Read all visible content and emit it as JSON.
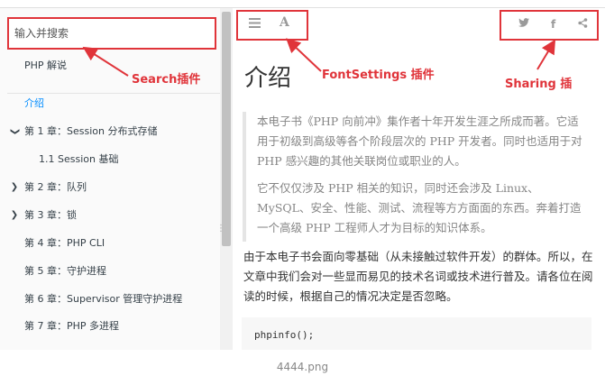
{
  "search": {
    "placeholder": "输入并搜索"
  },
  "sidebar": {
    "items": [
      {
        "label": "PHP 解说",
        "chevron": ""
      },
      {
        "label": "介绍",
        "chevron": ""
      },
      {
        "label": "第 1 章：Session 分布式存储",
        "chevron": "❯"
      },
      {
        "label": "1.1 Session 基础",
        "chevron": ""
      },
      {
        "label": "第 2 章：队列",
        "chevron": "❯"
      },
      {
        "label": "第 3 章：锁",
        "chevron": "❯"
      },
      {
        "label": "第 4 章：PHP CLI",
        "chevron": ""
      },
      {
        "label": "第 5 章：守护进程",
        "chevron": ""
      },
      {
        "label": "第 6 章：Supervisor 管理守护进程",
        "chevron": ""
      },
      {
        "label": "第 7 章：PHP 多进程",
        "chevron": ""
      }
    ],
    "active_index": 1,
    "expanded_index": 2
  },
  "toolbar": {
    "menu_icon": "hamburger-menu-icon",
    "font_icon": "font-settings-icon",
    "font_glyph": "A",
    "share_icons": [
      "twitter-icon",
      "facebook-icon",
      "share-icon"
    ],
    "twitter_glyph": "🐦",
    "facebook_glyph": "f",
    "share_glyph": "⋖"
  },
  "annotations": {
    "search": "Search插件",
    "font": "FontSettings 插件",
    "sharing": "Sharing 插",
    "color": "#e0343a"
  },
  "content": {
    "title": "介绍",
    "quote_p1": "本电子书《PHP 向前冲》集作者十年开发生涯之所成而著。它适用于初级到高级等各个阶段层次的 PHP 开发者。同时也适用于对 PHP 感兴趣的其他关联岗位或职业的人。",
    "quote_p2": "它不仅仅涉及 PHP 相关的知识，同时还会涉及 Linux、MySQL、安全、性能、测试、流程等方方面面的东西。奔着打造一个高级 PHP 工程师人才为目标的知识体系。",
    "body": "由于本电子书会面向零基础（从未接触过软件开发）的群体。所以，在文章中我们会对一些显而易见的技术名词或技术进行普及。请各位在阅读的时候，根据自己的情况决定是否忽略。",
    "code": "phpinfo();"
  },
  "caption": "4444.png"
}
